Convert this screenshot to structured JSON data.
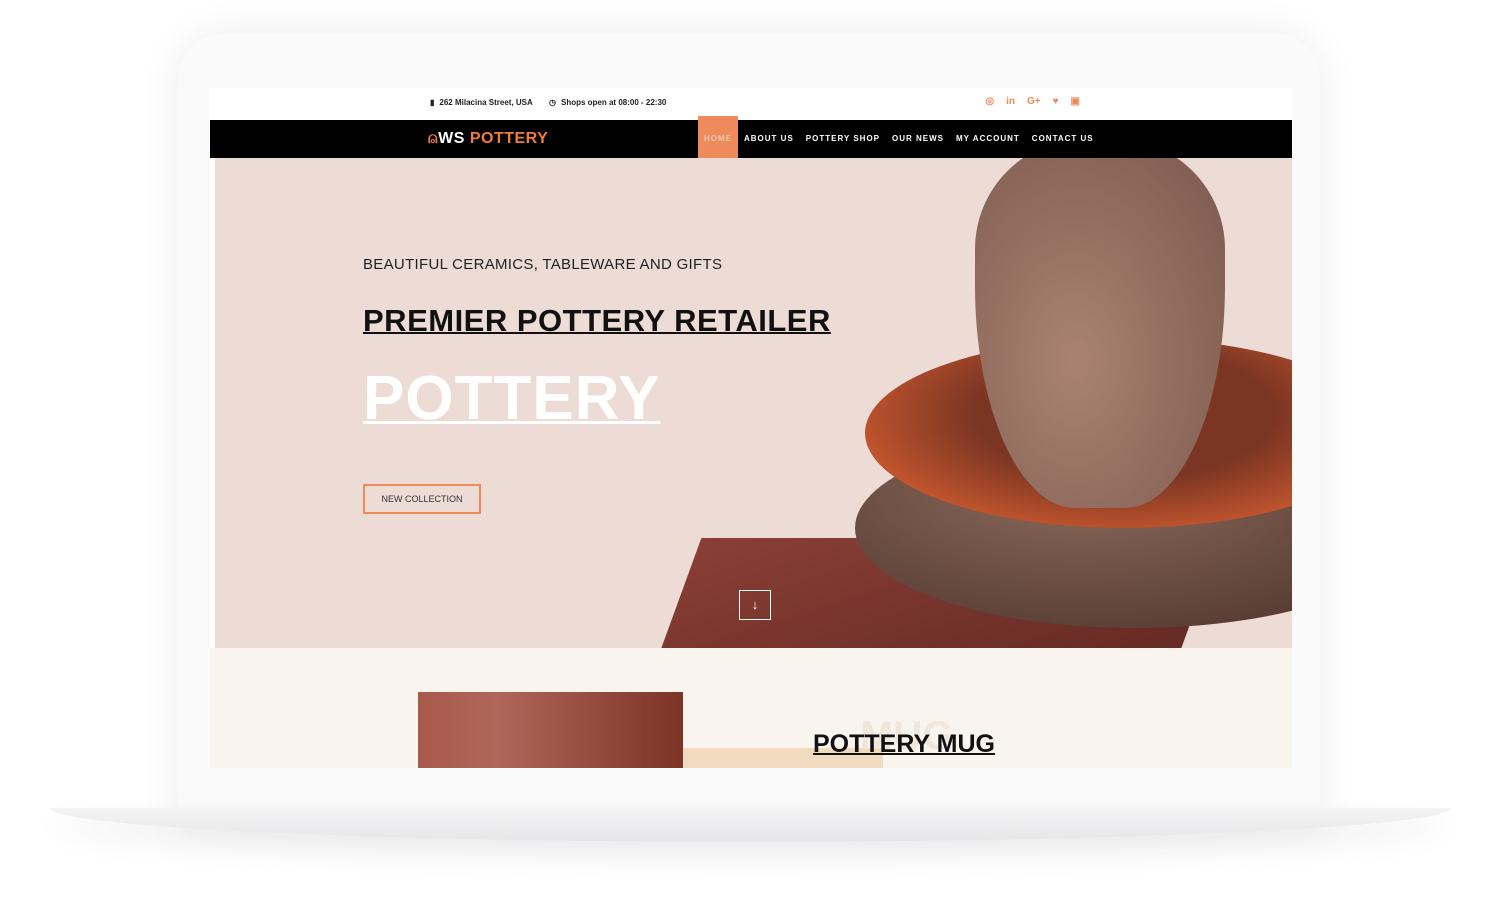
{
  "topbar": {
    "address": "262 Milacina Street, USA",
    "hours": "Shops open at 08:00 - 22:30",
    "social": [
      "instagram-icon",
      "linkedin-icon",
      "google-plus-icon",
      "twitter-icon",
      "youtube-icon"
    ]
  },
  "nav": {
    "logo_prefix": "WS",
    "logo_suffix": "POTTERY",
    "items": [
      "HOME",
      "ABOUT US",
      "POTTERY SHOP",
      "OUR NEWS",
      "MY ACCOUNT",
      "CONTACT US"
    ],
    "active": "HOME"
  },
  "hero": {
    "subtitle": "BEAUTIFUL CERAMICS, TABLEWARE AND GIFTS",
    "title": "PREMIER POTTERY RETAILER",
    "big": "POTTERY",
    "button": "NEW COLLECTION"
  },
  "section": {
    "ghost": "MUG",
    "title": "POTTERY MUG"
  },
  "colors": {
    "accent": "#ef8a58",
    "nav_bg": "#000000",
    "hero_bg": "#ecdcd5"
  }
}
